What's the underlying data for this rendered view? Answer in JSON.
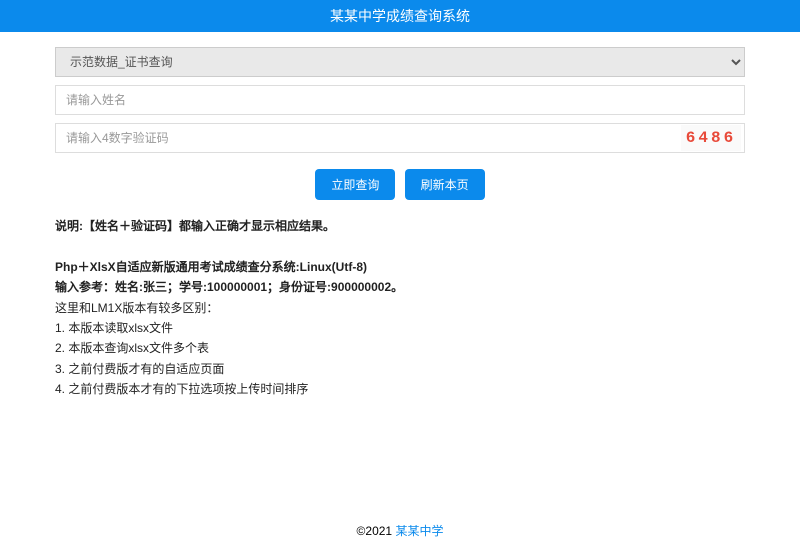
{
  "header": {
    "title": "某某中学成绩查询系统"
  },
  "form": {
    "selectValue": "示范数据_证书查询",
    "namePlaceholder": "请输入姓名",
    "captchaPlaceholder": "请输入4数字验证码",
    "captchaCode": "6486",
    "queryBtn": "立即查询",
    "refreshBtn": "刷新本页"
  },
  "info": {
    "line1": "说明:【姓名＋验证码】都输入正确才显示相应结果。",
    "line2": "Php＋XlsX自适应新版通用考试成绩查分系统:Linux(Utf-8)",
    "line3": "输入参考：姓名:张三；学号:100000001；身份证号:900000002。",
    "line4": "这里和LM1X版本有较多区别：",
    "line5": "1. 本版本读取xlsx文件",
    "line6": "2. 本版本查询xlsx文件多个表",
    "line7": "3. 之前付费版才有的自适应页面",
    "line8": "4. 之前付费版本才有的下拉选项按上传时间排序"
  },
  "footer": {
    "copyright": "©2021",
    "linkText": "某某中学"
  }
}
